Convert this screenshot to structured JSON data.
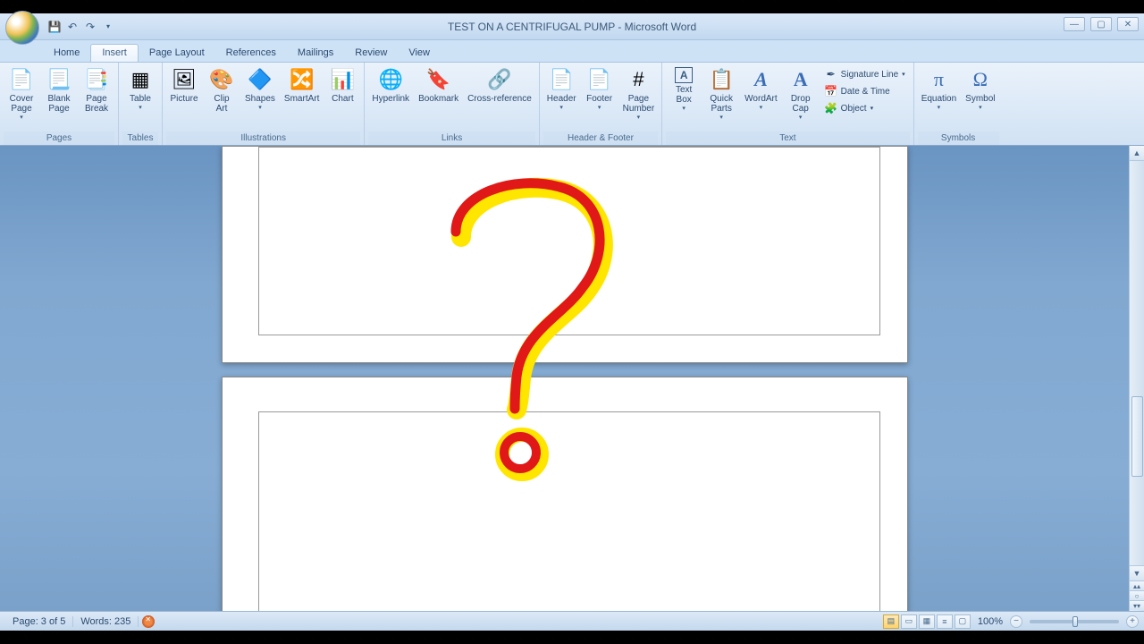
{
  "title": "TEST ON A CENTRIFUGAL PUMP - Microsoft Word",
  "tabs": [
    "Home",
    "Insert",
    "Page Layout",
    "References",
    "Mailings",
    "Review",
    "View"
  ],
  "active_tab": 1,
  "ribbon": {
    "pages": {
      "label": "Pages",
      "cover": "Cover\nPage",
      "blank": "Blank\nPage",
      "break": "Page\nBreak"
    },
    "tables": {
      "label": "Tables",
      "table": "Table"
    },
    "illustrations": {
      "label": "Illustrations",
      "picture": "Picture",
      "clipart": "Clip\nArt",
      "shapes": "Shapes",
      "smartart": "SmartArt",
      "chart": "Chart"
    },
    "links": {
      "label": "Links",
      "hyperlink": "Hyperlink",
      "bookmark": "Bookmark",
      "crossref": "Cross-reference"
    },
    "headerfooter": {
      "label": "Header & Footer",
      "header": "Header",
      "footer": "Footer",
      "pagenum": "Page\nNumber"
    },
    "text": {
      "label": "Text",
      "textbox": "Text\nBox",
      "quickparts": "Quick\nParts",
      "wordart": "WordArt",
      "dropcap": "Drop\nCap",
      "sigline": "Signature Line",
      "datetime": "Date & Time",
      "object": "Object"
    },
    "symbols": {
      "label": "Symbols",
      "equation": "Equation",
      "symbol": "Symbol"
    }
  },
  "status": {
    "page": "Page: 3 of 5",
    "words": "Words: 235",
    "zoom": "100%"
  }
}
